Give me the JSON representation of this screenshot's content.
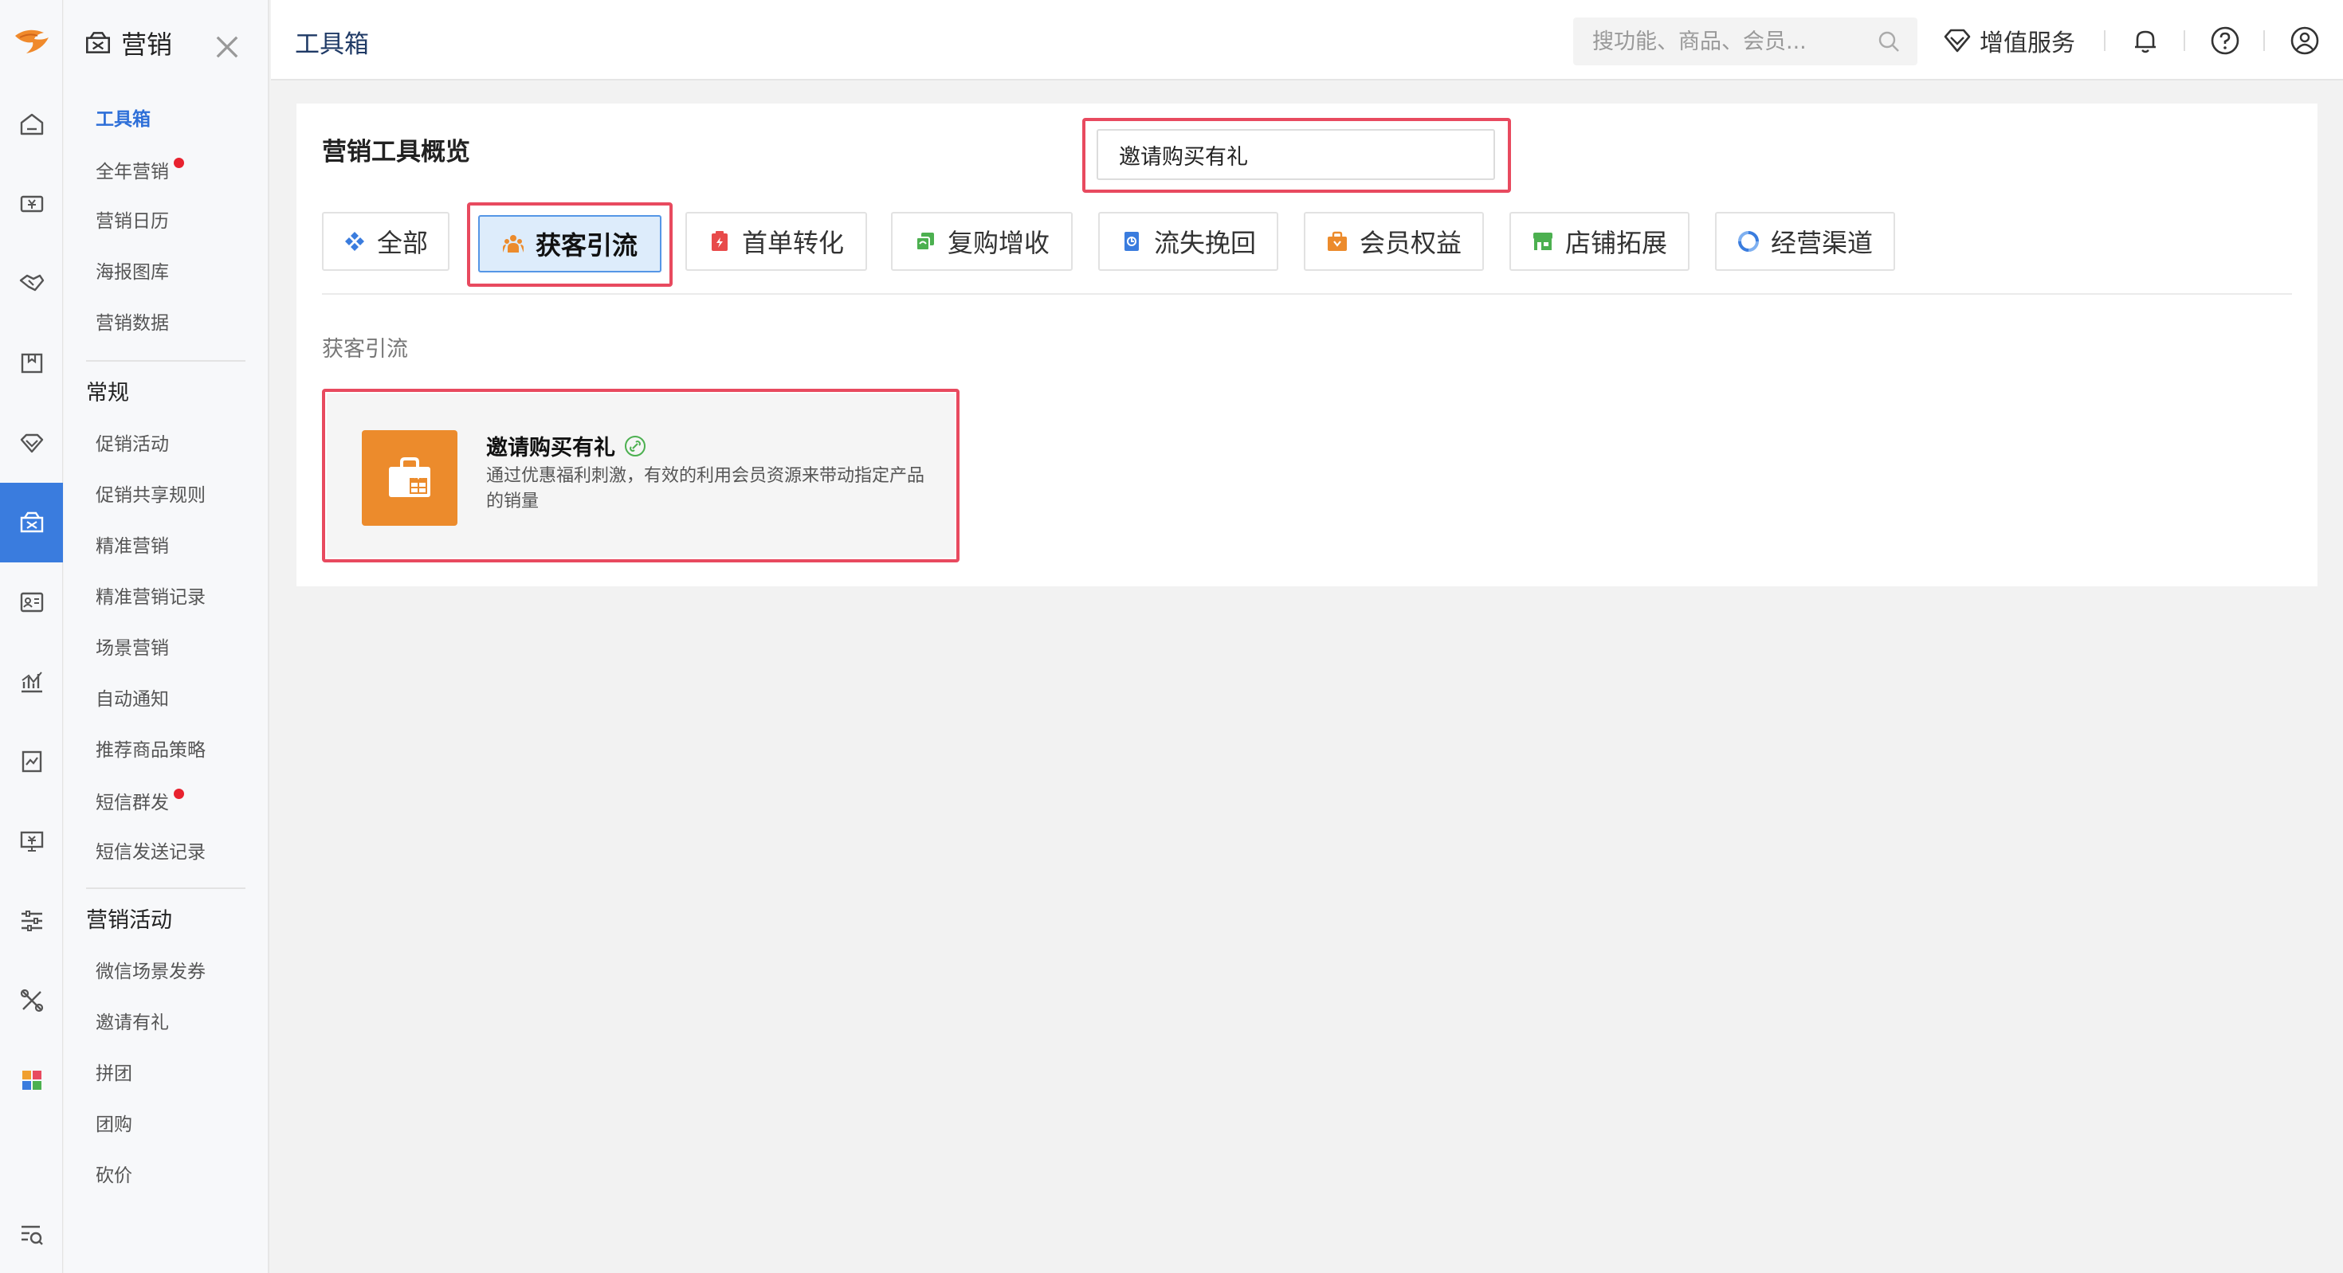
{
  "topbar": {
    "title": "工具箱",
    "search_placeholder": "搜功能、商品、会员...",
    "value_added_label": "增值服务"
  },
  "rail": {
    "items": [
      "home-icon",
      "cashier-icon",
      "handshake-icon",
      "goods-icon",
      "diamond-icon",
      "marketing-icon",
      "member-card-icon",
      "chart-icon",
      "report-icon",
      "monitor-icon",
      "settings-sliders-icon",
      "tools-icon",
      "apps-icon",
      "search-list-icon"
    ],
    "active": "marketing-icon",
    "accent": "#3a7cde"
  },
  "subnav": {
    "title": "营销",
    "items_top": [
      {
        "label": "工具箱",
        "active": true,
        "dot": false
      },
      {
        "label": "全年营销",
        "active": false,
        "dot": true
      },
      {
        "label": "营销日历",
        "active": false,
        "dot": false
      },
      {
        "label": "海报图库",
        "active": false,
        "dot": false
      },
      {
        "label": "营销数据",
        "active": false,
        "dot": false
      }
    ],
    "group_regular": "常规",
    "items_regular": [
      {
        "label": "促销活动",
        "dot": false
      },
      {
        "label": "促销共享规则",
        "dot": false
      },
      {
        "label": "精准营销",
        "dot": false
      },
      {
        "label": "精准营销记录",
        "dot": false
      },
      {
        "label": "场景营销",
        "dot": false
      },
      {
        "label": "自动通知",
        "dot": false
      },
      {
        "label": "推荐商品策略",
        "dot": false
      },
      {
        "label": "短信群发",
        "dot": true
      },
      {
        "label": "短信发送记录",
        "dot": false
      }
    ],
    "group_activity": "营销活动",
    "items_activity": [
      {
        "label": "微信场景发券"
      },
      {
        "label": "邀请有礼"
      },
      {
        "label": "拼团"
      },
      {
        "label": "团购"
      },
      {
        "label": "砍价"
      }
    ]
  },
  "panel": {
    "title": "营销工具概览",
    "search_value": "邀请购买有礼",
    "tabs": [
      {
        "label": "全部",
        "icon": "all-icon",
        "active": false
      },
      {
        "label": "获客引流",
        "icon": "customer-acquire-icon",
        "active": true
      },
      {
        "label": "首单转化",
        "icon": "first-order-icon",
        "active": false
      },
      {
        "label": "复购增收",
        "icon": "repurchase-icon",
        "active": false
      },
      {
        "label": "流失挽回",
        "icon": "churn-recall-icon",
        "active": false
      },
      {
        "label": "会员权益",
        "icon": "member-benefit-icon",
        "active": false
      },
      {
        "label": "店铺拓展",
        "icon": "store-expand-icon",
        "active": false
      },
      {
        "label": "经营渠道",
        "icon": "channel-icon",
        "active": false
      }
    ],
    "section_label": "获客引流",
    "card": {
      "title": "邀请购买有礼",
      "description": "通过优惠福利刺激，有效的利用会员资源来带动指定产品的销量",
      "icon": "gift-bag-icon",
      "icon_color": "#ec8b2c"
    }
  },
  "highlight_color": "#e84a5f"
}
